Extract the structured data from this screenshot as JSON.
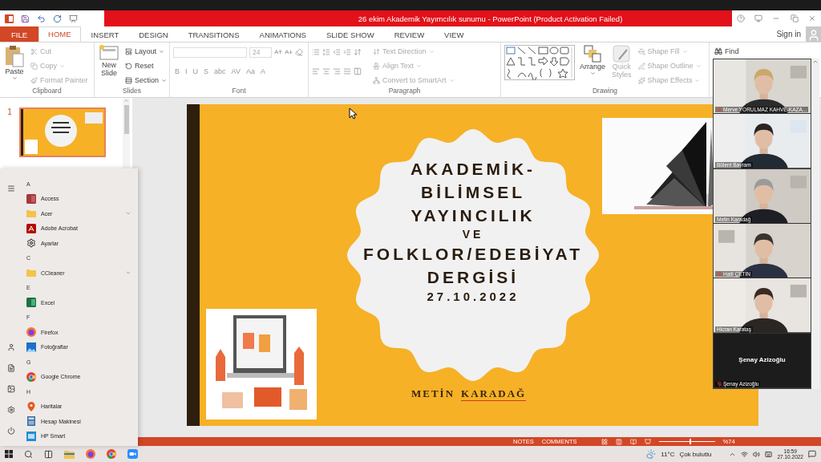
{
  "window": {
    "title": "26 ekim Akademik Yayımcılık sunumu -  PowerPoint (Product Activation Failed)"
  },
  "ribbon_tabs": [
    {
      "label": "FILE",
      "kind": "file",
      "selected": false
    },
    {
      "label": "HOME",
      "kind": "tab",
      "selected": true
    },
    {
      "label": "INSERT",
      "kind": "tab",
      "selected": false
    },
    {
      "label": "DESIGN",
      "kind": "tab",
      "selected": false
    },
    {
      "label": "TRANSITIONS",
      "kind": "tab",
      "selected": false
    },
    {
      "label": "ANIMATIONS",
      "kind": "tab",
      "selected": false
    },
    {
      "label": "SLIDE SHOW",
      "kind": "tab",
      "selected": false
    },
    {
      "label": "REVIEW",
      "kind": "tab",
      "selected": false
    },
    {
      "label": "VIEW",
      "kind": "tab",
      "selected": false
    }
  ],
  "account": {
    "label": "Sign in"
  },
  "ribbon": {
    "clipboard": {
      "label": "Clipboard",
      "paste": "Paste",
      "items": [
        {
          "label": "Cut",
          "disabled": true,
          "has_menu": false
        },
        {
          "label": "Copy",
          "disabled": true,
          "has_menu": true
        },
        {
          "label": "Format Painter",
          "disabled": true,
          "has_menu": false
        }
      ]
    },
    "slides": {
      "label": "Slides",
      "new_slide": [
        "New",
        "Slide"
      ],
      "items": [
        {
          "label": "Layout",
          "disabled": false,
          "has_menu": true
        },
        {
          "label": "Reset",
          "disabled": false,
          "has_menu": false
        },
        {
          "label": "Section",
          "disabled": false,
          "has_menu": true
        }
      ]
    },
    "font": {
      "label": "Font",
      "font_size": "24",
      "buttons": [
        "B",
        "I",
        "U",
        "S",
        "abc",
        "AV",
        "Aa",
        "A"
      ]
    },
    "paragraph": {
      "label": "Paragraph",
      "items": [
        {
          "label": "Text Direction",
          "disabled": true,
          "has_menu": true
        },
        {
          "label": "Align Text",
          "disabled": true,
          "has_menu": true
        },
        {
          "label": "Convert to SmartArt",
          "disabled": true,
          "has_menu": true
        }
      ]
    },
    "drawing": {
      "label": "Drawing",
      "arrange": "Arrange",
      "quick_styles": [
        "Quick",
        "Styles"
      ],
      "items": [
        {
          "label": "Shape Fill",
          "disabled": true,
          "has_menu": true
        },
        {
          "label": "Shape Outline",
          "disabled": true,
          "has_menu": true
        },
        {
          "label": "Shape Effects",
          "disabled": true,
          "has_menu": true
        }
      ]
    },
    "editing": {
      "find": "Find"
    }
  },
  "slide_pane": {
    "slides": [
      {
        "number": "1",
        "selected": true
      }
    ]
  },
  "slide": {
    "title_lines": [
      {
        "text": "AKADEMİK-",
        "kind": "large"
      },
      {
        "text": "BİLİMSEL",
        "kind": "large"
      },
      {
        "text": "YAYINCILIK",
        "kind": "large"
      },
      {
        "text": "VE",
        "kind": "small"
      },
      {
        "text": "FOLKLOR/EDEBİYAT",
        "kind": "large"
      },
      {
        "text": "DERGİSİ",
        "kind": "large"
      }
    ],
    "date": "27.10.2022",
    "author": {
      "first": "METİN",
      "last": "KARADAĞ"
    }
  },
  "status_bar": {
    "notes": "NOTES",
    "comments": "COMMENTS",
    "zoom": "%74",
    "zoom_slider": {
      "level": 0.55
    }
  },
  "start_menu": {
    "items": [
      {
        "kind": "letter",
        "label": "A"
      },
      {
        "kind": "app",
        "label": "Access",
        "expandable": false
      },
      {
        "kind": "app",
        "label": "Acer",
        "expandable": true
      },
      {
        "kind": "app",
        "label": "Adobe Acrobat",
        "expandable": false
      },
      {
        "kind": "app",
        "label": "Ayarlar",
        "expandable": false
      },
      {
        "kind": "letter",
        "label": "C"
      },
      {
        "kind": "app",
        "label": "CCleaner",
        "expandable": true
      },
      {
        "kind": "letter",
        "label": "E"
      },
      {
        "kind": "app",
        "label": "Excel",
        "expandable": false
      },
      {
        "kind": "letter",
        "label": "F"
      },
      {
        "kind": "app",
        "label": "Firefox",
        "expandable": false
      },
      {
        "kind": "app",
        "label": "Fotoğraflar",
        "expandable": false
      },
      {
        "kind": "letter",
        "label": "G"
      },
      {
        "kind": "app",
        "label": "Google Chrome",
        "expandable": false
      },
      {
        "kind": "letter",
        "label": "H"
      },
      {
        "kind": "app",
        "label": "Haritalar",
        "expandable": false
      },
      {
        "kind": "app",
        "label": "Hesap Makinesi",
        "expandable": false
      },
      {
        "kind": "app",
        "label": "HP Smart",
        "expandable": false
      }
    ]
  },
  "participants": [
    {
      "name": "Merve YORULMAZ KAHVE-KAZA...",
      "kind": "video",
      "muted": true
    },
    {
      "name": "Bülent Bayram",
      "kind": "video",
      "muted": false
    },
    {
      "name": "Metin Karadağ",
      "kind": "video",
      "muted": false
    },
    {
      "name": "Halil ÇETİN",
      "kind": "video",
      "muted": true
    },
    {
      "name": "Hicran Karataş",
      "kind": "video",
      "muted": false
    },
    {
      "name": "Şenay Azizoğlu",
      "kind": "name",
      "muted": true,
      "display_name": "Şenay Azizoğlu"
    }
  ],
  "taskbar": {
    "weather": {
      "temperature": "11°C",
      "condition": "Çok bulutlu"
    },
    "clock": {
      "time": "16:59",
      "date": "27.10.2022"
    }
  }
}
